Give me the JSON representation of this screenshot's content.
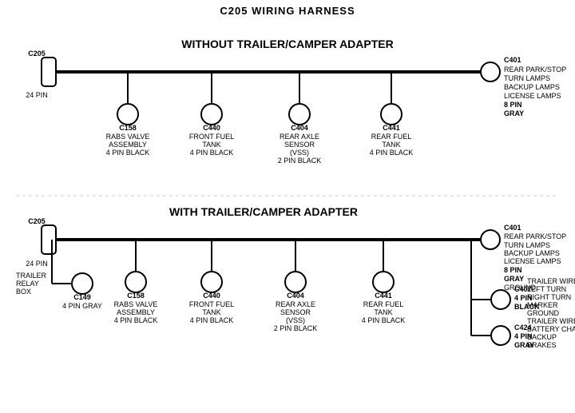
{
  "title": "C205 WIRING HARNESS",
  "section1": {
    "label": "WITHOUT  TRAILER/CAMPER ADAPTER",
    "left_connector": {
      "id": "C205",
      "pins": "24 PIN"
    },
    "right_connector": {
      "id": "C401",
      "pins": "8 PIN",
      "color": "GRAY",
      "labels": [
        "REAR PARK/STOP",
        "TURN LAMPS",
        "BACKUP LAMPS",
        "LICENSE LAMPS"
      ]
    },
    "connectors": [
      {
        "id": "C158",
        "label": "RABS VALVE\nASSEMBLY\n4 PIN BLACK"
      },
      {
        "id": "C440",
        "label": "FRONT FUEL\nTANK\n4 PIN BLACK"
      },
      {
        "id": "C404",
        "label": "REAR AXLE\nSENSOR\n(VSS)\n2 PIN BLACK"
      },
      {
        "id": "C441",
        "label": "REAR FUEL\nTANK\n4 PIN BLACK"
      }
    ]
  },
  "section2": {
    "label": "WITH TRAILER/CAMPER ADAPTER",
    "left_connector": {
      "id": "C205",
      "pins": "24 PIN"
    },
    "right_connector": {
      "id": "C401",
      "pins": "8 PIN",
      "color": "GRAY",
      "labels": [
        "REAR PARK/STOP",
        "TURN LAMPS",
        "BACKUP LAMPS",
        "LICENSE LAMPS",
        "GROUND"
      ]
    },
    "extra_left": {
      "id": "C149",
      "label": "TRAILER\nRELAY\nBOX",
      "pins": "4 PIN GRAY"
    },
    "connectors": [
      {
        "id": "C158",
        "label": "RABS VALVE\nASSEMBLY\n4 PIN BLACK"
      },
      {
        "id": "C440",
        "label": "FRONT FUEL\nTANK\n4 PIN BLACK"
      },
      {
        "id": "C404",
        "label": "REAR AXLE\nSENSOR\n(VSS)\n2 PIN BLACK"
      },
      {
        "id": "C441",
        "label": "REAR FUEL\nTANK\n4 PIN BLACK"
      }
    ],
    "right_connectors": [
      {
        "id": "C407",
        "pins": "4 PIN\nBLACK",
        "labels": [
          "TRAILER WIRES",
          "LEFT TURN",
          "RIGHT TURN",
          "MARKER",
          "GROUND"
        ]
      },
      {
        "id": "C424",
        "pins": "4 PIN\nGRAY",
        "labels": [
          "TRAILER WIRES",
          "BATTERY CHARGE",
          "BACKUP",
          "BRAKES"
        ]
      }
    ]
  }
}
